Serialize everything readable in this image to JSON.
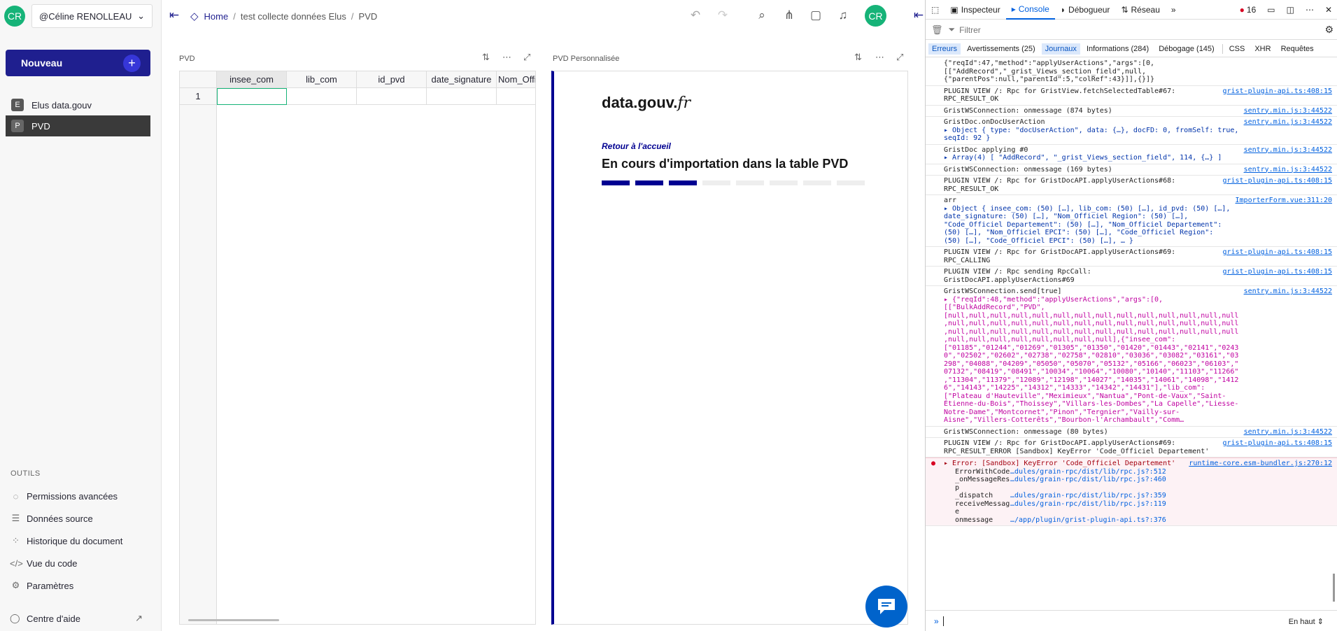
{
  "sidebar": {
    "avatar_initials": "CR",
    "org_name": "@Céline RENOLLEAU",
    "new_label": "Nouveau",
    "pages": [
      {
        "icon": "E",
        "label": "Elus data.gouv"
      },
      {
        "icon": "P",
        "label": "PVD"
      }
    ],
    "tools_heading": "OUTILS",
    "tools": [
      {
        "icon": "shield-icon",
        "label": "Permissions avancées"
      },
      {
        "icon": "database-icon",
        "label": "Données source"
      },
      {
        "icon": "history-icon",
        "label": "Historique du document"
      },
      {
        "icon": "code-icon",
        "label": "Vue du code"
      },
      {
        "icon": "gear-icon",
        "label": "Paramètres"
      }
    ],
    "help_label": "Centre d'aide"
  },
  "topbar": {
    "breadcrumb": [
      "Home",
      "test collecte données Elus",
      "PVD"
    ],
    "avatar_initials": "CR"
  },
  "widgets": {
    "table": {
      "title": "PVD",
      "columns": [
        "insee_com",
        "lib_com",
        "id_pvd",
        "date_signature",
        "Nom_Offi"
      ],
      "row_numbers": [
        "1"
      ]
    },
    "custom": {
      "title": "PVD Personnalisée",
      "logo_main": "data.gouv.",
      "logo_suffix": "fr",
      "back_link": "Retour à l'accueil",
      "heading": "En cours d'importation dans la table PVD",
      "progress": {
        "filled": 3,
        "total": 8
      }
    }
  },
  "devtools": {
    "tabs": [
      "Inspecteur",
      "Console",
      "Débogueur",
      "Réseau"
    ],
    "error_count": "16",
    "filter_placeholder": "Filtrer",
    "categories": [
      "Erreurs",
      "Avertissements (25)",
      "Journaux",
      "Informations (284)",
      "Débogage (145)",
      "CSS",
      "XHR",
      "Requêtes"
    ],
    "messages": [
      {
        "text": "{\"reqId\":47,\"method\":\"applyUserActions\",\"args\":[0,\n[[\"AddRecord\",\"_grist_Views_section_field\",null,\n{\"parentPos\":null,\"parentId\":5,\"colRef\":43}]],{}]}",
        "source": ""
      },
      {
        "text": "PLUGIN VIEW /: Rpc for GristView.fetchSelectedTable#67:\nRPC_RESULT_OK",
        "source": "grist-plugin-api.ts:408:15"
      },
      {
        "text": "GristWSConnection: onmessage (874 bytes)",
        "source": "sentry.min.js:3:44522"
      },
      {
        "text": "GristDoc.onDocUserAction",
        "sub": "▸ Object { type: \"docUserAction\", data: {…}, docFD: 0, fromSelf: true,\nseqId: 92 }",
        "source": "sentry.min.js:3:44522"
      },
      {
        "text": "GristDoc applying #0",
        "sub": "▸ Array(4) [ \"AddRecord\", \"_grist_Views_section_field\", 114, {…} ]",
        "source": "sentry.min.js:3:44522"
      },
      {
        "text": "GristWSConnection: onmessage (169 bytes)",
        "source": "sentry.min.js:3:44522"
      },
      {
        "text": "PLUGIN VIEW /: Rpc for GristDocAPI.applyUserActions#68:\nRPC_RESULT_OK",
        "source": "grist-plugin-api.ts:408:15"
      },
      {
        "text": "arr",
        "sub": "▸ Object { insee_com: (50) […], lib_com: (50) […], id_pvd: (50) […],\ndate_signature: (50) […], \"Nom_Officiel Region\": (50) […],\n\"Code_Officiel Departement\": (50) […], \"Nom_Officiel Departement\":\n(50) […], \"Nom_Officiel EPCI\": (50) […], \"Code_Officiel Region\":\n(50) […], \"Code_Officiel EPCI\": (50) […], … }",
        "source": "ImporterForm.vue:311:20"
      },
      {
        "text": "PLUGIN VIEW /: Rpc for GristDocAPI.applyUserActions#69:\nRPC_CALLING",
        "source": "grist-plugin-api.ts:408:15"
      },
      {
        "text": "PLUGIN VIEW /: Rpc sending RpcCall:\nGristDocAPI.applyUserActions#69",
        "source": "grist-plugin-api.ts:408:15"
      },
      {
        "text": "GristWSConnection.send[true]",
        "str": "▸ {\"reqId\":48,\"method\":\"applyUserActions\",\"args\":[0,\n[[\"BulkAddRecord\",\"PVD\",\n[null,null,null,null,null,null,null,null,null,null,null,null,null,null\n,null,null,null,null,null,null,null,null,null,null,null,null,null,null\n,null,null,null,null,null,null,null,null,null,null,null,null,null,null\n,null,null,null,null,null,null,null,null],{\"insee_com\":\n[\"01185\",\"01244\",\"01269\",\"01305\",\"01350\",\"01420\",\"01443\",\"02141\",\"0243\n0\",\"02502\",\"02602\",\"02738\",\"02758\",\"02810\",\"03036\",\"03082\",\"03161\",\"03\n298\",\"04088\",\"04209\",\"05050\",\"05070\",\"05132\",\"05166\",\"06023\",\"06103\",\"\n07132\",\"08419\",\"08491\",\"10034\",\"10064\",\"10080\",\"10140\",\"11103\",\"11266\"\n,\"11304\",\"11379\",\"12089\",\"12198\",\"14027\",\"14035\",\"14061\",\"14098\",\"1412\n6\",\"14143\",\"14225\",\"14312\",\"14333\",\"14342\",\"14431\"],\"lib_com\":\n[\"Plateau d'Hauteville\",\"Meximieux\",\"Nantua\",\"Pont-de-Vaux\",\"Saint-\nÉtienne-du-Bois\",\"Thoissey\",\"Villars-les-Dombes\",\"La Capelle\",\"Liesse-\nNotre-Dame\",\"Montcornet\",\"Pinon\",\"Tergnier\",\"Vailly-sur-\nAisne\",\"Villers-Cotterêts\",\"Bourbon-l'Archambault\",\"Comm…",
        "source": "sentry.min.js:3:44522"
      },
      {
        "text": "GristWSConnection: onmessage (80 bytes)",
        "source": "sentry.min.js:3:44522"
      },
      {
        "text": "PLUGIN VIEW /: Rpc for GristDocAPI.applyUserActions#69:\nRPC_RESULT_ERROR [Sandbox] KeyError 'Code_Officiel Departement'",
        "source": "grist-plugin-api.ts:408:15"
      }
    ],
    "error": {
      "text": "▸ Error: [Sandbox] KeyError 'Code_Officiel Departement'",
      "source": "runtime-core.esm-bundler.js:270:12",
      "stack": [
        {
          "fn": "ErrorWithCode",
          "loc": "…dules/grain-rpc/dist/lib/rpc.js?:512"
        },
        {
          "fn": "_onMessageResp",
          "loc": "…dules/grain-rpc/dist/lib/rpc.js?:460"
        },
        {
          "fn": "_dispatch",
          "loc": "…dules/grain-rpc/dist/lib/rpc.js?:359"
        },
        {
          "fn": "receiveMessage",
          "loc": "…dules/grain-rpc/dist/lib/rpc.js?:119"
        },
        {
          "fn": "onmessage",
          "loc": "…/app/plugin/grist-plugin-api.ts?:376"
        }
      ]
    },
    "scroll_position": "En haut"
  }
}
